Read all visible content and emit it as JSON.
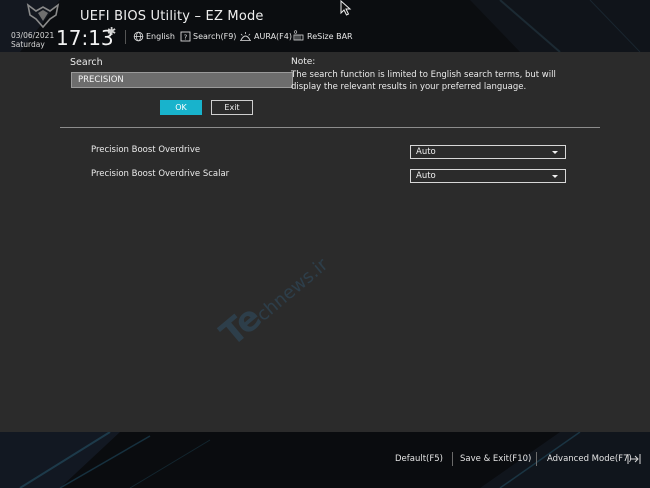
{
  "header": {
    "title": "UEFI BIOS Utility – EZ Mode",
    "date": "03/06/2021",
    "day": "Saturday",
    "time": "17:13",
    "items": [
      {
        "label": "English",
        "icon": "globe-icon"
      },
      {
        "label": "Search(F9)",
        "icon": "help-box-icon"
      },
      {
        "label": "AURA(F4)",
        "icon": "aura-icon"
      },
      {
        "label": "ReSize BAR",
        "icon": "resize-bar-icon"
      }
    ]
  },
  "search": {
    "label": "Search",
    "value": "PRECISION",
    "ok_label": "OK",
    "exit_label": "Exit"
  },
  "note": {
    "title": "Note:",
    "text": "The search function is limited to English search terms, but will display the relevant results in your preferred language."
  },
  "results": [
    {
      "label": "Precision Boost Overdrive",
      "value": "Auto"
    },
    {
      "label": "Precision Boost Overdrive Scalar",
      "value": "Auto"
    }
  ],
  "watermark": {
    "text_big": "Te",
    "text_small": "chnews.ir"
  },
  "footer": {
    "items": [
      {
        "label": "Default(F5)"
      },
      {
        "label": "Save & Exit(F10)"
      },
      {
        "label": "Advanced Mode(F7)"
      }
    ]
  },
  "colors": {
    "accent": "#18b3cc",
    "background": "#2b2b2b",
    "header_background": "#0b0d10"
  }
}
